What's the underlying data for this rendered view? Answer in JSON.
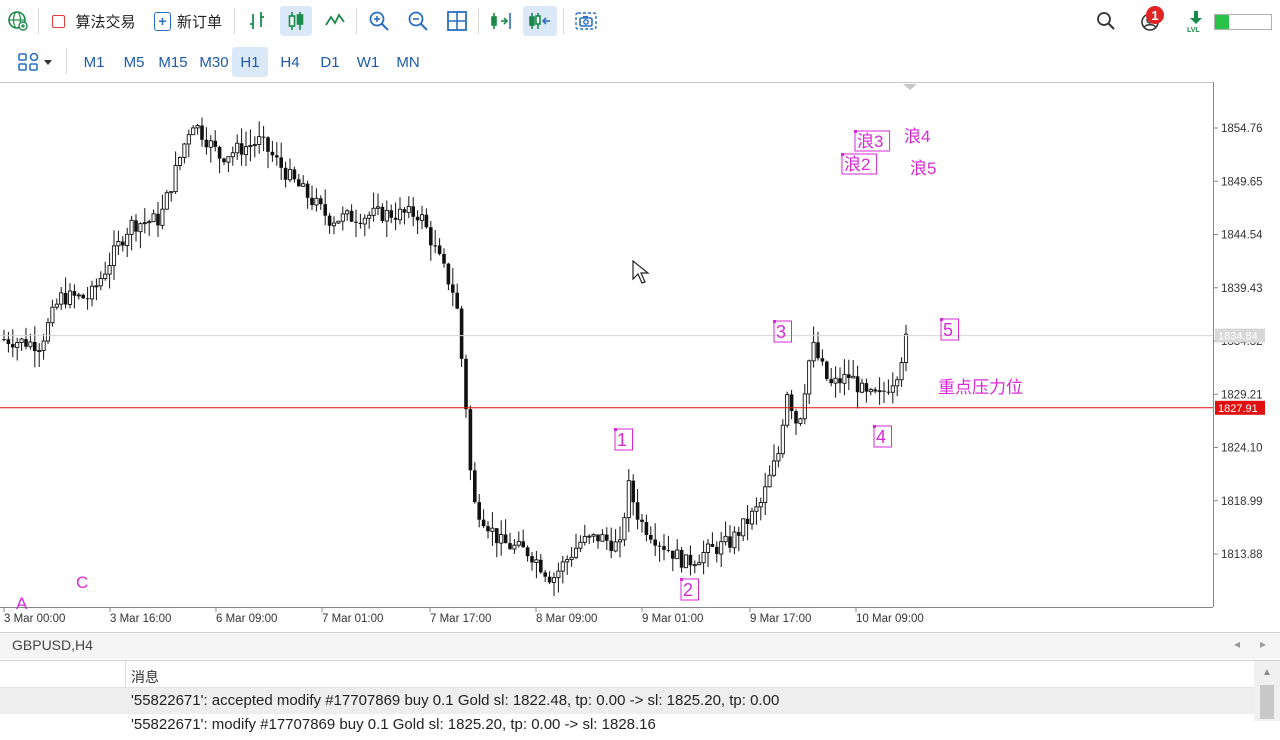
{
  "toolbar": {
    "algo_trading_label": "算法交易",
    "new_order_label": "新订单"
  },
  "timeframes": [
    "M1",
    "M5",
    "M15",
    "M30",
    "H1",
    "H4",
    "D1",
    "W1",
    "MN"
  ],
  "active_timeframe": "H1",
  "notifications_count": "1",
  "chart": {
    "y_ticks": [
      "1854.76",
      "1849.65",
      "1844.54",
      "1839.43",
      "1834.32",
      "1829.21",
      "1824.10",
      "1818.99",
      "1813.88"
    ],
    "x_ticks": [
      "3 Mar 00:00",
      "3 Mar 16:00",
      "6 Mar 09:00",
      "7 Mar 01:00",
      "7 Mar 17:00",
      "8 Mar 09:00",
      "9 Mar 01:00",
      "9 Mar 17:00",
      "10 Mar 09:00"
    ],
    "current_price": "1834.84",
    "line_price": "1827.91",
    "line_color": "#e01010",
    "label_color": "#d82ad8",
    "annotations": {
      "w1": "1",
      "w2": "2",
      "w3": "3",
      "w4": "4",
      "w5": "5",
      "a": "A",
      "c": "C",
      "lang2": "浪2",
      "lang3": "浪3",
      "lang4": "浪4",
      "lang5": "浪5",
      "resistance": "重点压力位"
    }
  },
  "symbol_bar": {
    "symbol": "GBPUSD,H4"
  },
  "log": {
    "header": "消息",
    "line1": "'55822671': accepted modify #17707869 buy 0.1 Gold sl: 1822.48, tp: 0.00 -> sl: 1825.20, tp: 0.00",
    "line2": "'55822671': modify #17707869 buy 0.1 Gold sl: 1825.20, tp: 0.00 -> sl: 1828.16"
  }
}
